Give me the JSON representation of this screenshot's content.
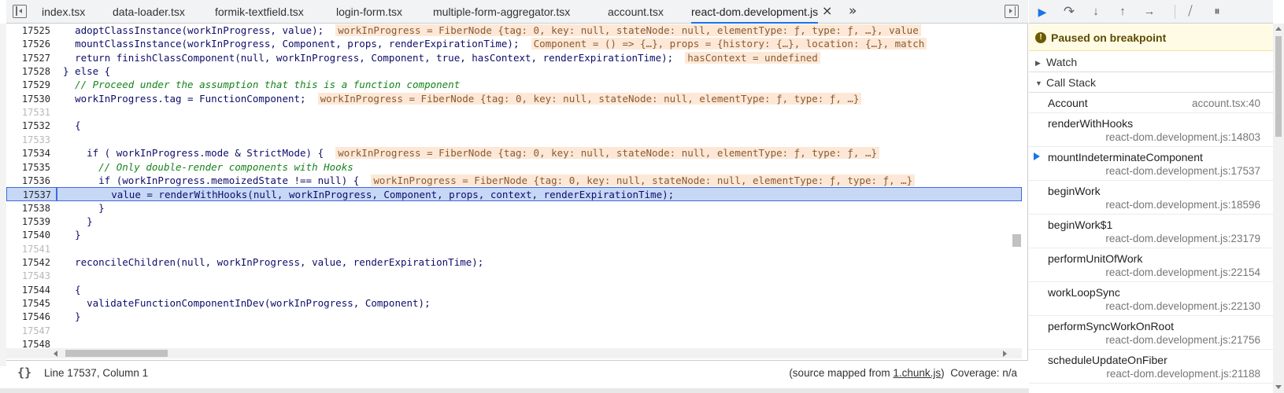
{
  "tabs": [
    {
      "label": "index.tsx",
      "active": false
    },
    {
      "label": "data-loader.tsx",
      "active": false
    },
    {
      "label": "formik-textfield.tsx",
      "active": false
    },
    {
      "label": "login-form.tsx",
      "active": false
    },
    {
      "label": "multiple-form-aggregator.tsx",
      "active": false
    },
    {
      "label": "account.tsx",
      "active": false
    },
    {
      "label": "react-dom.development.js",
      "active": true
    }
  ],
  "tab_close_glyph": "×",
  "tab_more_glyph": "»",
  "code_lines": [
    {
      "num": "17525",
      "dim": false,
      "indent": "  ",
      "code": "adoptClassInstance(workInProgress, value);",
      "inline": "workInProgress = FiberNode {tag: 0, key: null, stateNode: null, elementType: ƒ, type: ƒ, …}, value"
    },
    {
      "num": "17526",
      "dim": false,
      "indent": "  ",
      "code": "mountClassInstance(workInProgress, Component, props, renderExpirationTime);",
      "inline": "Component = () => {…}, props = {history: {…}, location: {…}, match"
    },
    {
      "num": "17527",
      "dim": false,
      "indent": "  ",
      "code": "return finishClassComponent(null, workInProgress, Component, true, hasContext, renderExpirationTime);",
      "inline": "hasContext = undefined"
    },
    {
      "num": "17528",
      "dim": false,
      "indent": "",
      "code": "} else {",
      "inline": ""
    },
    {
      "num": "17529",
      "dim": false,
      "indent": "  ",
      "code": "// Proceed under the assumption that this is a function component",
      "inline": "",
      "comment": true
    },
    {
      "num": "17530",
      "dim": false,
      "indent": "  ",
      "code": "workInProgress.tag = FunctionComponent;",
      "inline": "workInProgress = FiberNode {tag: 0, key: null, stateNode: null, elementType: ƒ, type: ƒ, …}"
    },
    {
      "num": "17531",
      "dim": true,
      "indent": "",
      "code": "",
      "inline": ""
    },
    {
      "num": "17532",
      "dim": false,
      "indent": "  ",
      "code": "{",
      "inline": ""
    },
    {
      "num": "17533",
      "dim": true,
      "indent": "",
      "code": "",
      "inline": ""
    },
    {
      "num": "17534",
      "dim": false,
      "indent": "    ",
      "code": "if ( workInProgress.mode & StrictMode) {",
      "inline": "workInProgress = FiberNode {tag: 0, key: null, stateNode: null, elementType: ƒ, type: ƒ, …}"
    },
    {
      "num": "17535",
      "dim": false,
      "indent": "      ",
      "code": "// Only double-render components with Hooks",
      "inline": "",
      "comment": true
    },
    {
      "num": "17536",
      "dim": false,
      "indent": "      ",
      "code": "if (workInProgress.memoizedState !== null) {",
      "inline": "workInProgress = FiberNode {tag: 0, key: null, stateNode: null, elementType: ƒ, type: ƒ, …}"
    },
    {
      "num": "17537",
      "dim": false,
      "indent": "        ",
      "code": "value = renderWithHooks(null, workInProgress, Component, props, context, renderExpirationTime);",
      "inline": "",
      "current": true
    },
    {
      "num": "17538",
      "dim": false,
      "indent": "      ",
      "code": "}",
      "inline": ""
    },
    {
      "num": "17539",
      "dim": false,
      "indent": "    ",
      "code": "}",
      "inline": ""
    },
    {
      "num": "17540",
      "dim": false,
      "indent": "  ",
      "code": "}",
      "inline": ""
    },
    {
      "num": "17541",
      "dim": true,
      "indent": "",
      "code": "",
      "inline": ""
    },
    {
      "num": "17542",
      "dim": false,
      "indent": "  ",
      "code": "reconcileChildren(null, workInProgress, value, renderExpirationTime);",
      "inline": ""
    },
    {
      "num": "17543",
      "dim": true,
      "indent": "",
      "code": "",
      "inline": ""
    },
    {
      "num": "17544",
      "dim": false,
      "indent": "  ",
      "code": "{",
      "inline": ""
    },
    {
      "num": "17545",
      "dim": false,
      "indent": "    ",
      "code": "validateFunctionComponentInDev(workInProgress, Component);",
      "inline": ""
    },
    {
      "num": "17546",
      "dim": false,
      "indent": "  ",
      "code": "}",
      "inline": ""
    },
    {
      "num": "17547",
      "dim": true,
      "indent": "",
      "code": "",
      "inline": ""
    },
    {
      "num": "17548",
      "dim": false,
      "indent": "",
      "code": "",
      "inline": ""
    }
  ],
  "status": {
    "pretty_print_glyph": "{}",
    "position": "Line 17537, Column 1",
    "source_mapped_prefix": "(source mapped from ",
    "source_mapped_link": "1.chunk.js",
    "source_mapped_suffix": ")",
    "coverage": "Coverage: n/a"
  },
  "debugger": {
    "paused_text": "Paused on breakpoint",
    "paused_glyph": "!",
    "watch_label": "Watch",
    "callstack_label": "Call Stack",
    "frames": [
      {
        "fn": "Account",
        "loc": "account.tsx:40",
        "inline": true,
        "current": false
      },
      {
        "fn": "renderWithHooks",
        "loc": "react-dom.development.js:14803",
        "inline": false,
        "current": false
      },
      {
        "fn": "mountIndeterminateComponent",
        "loc": "react-dom.development.js:17537",
        "inline": false,
        "current": true
      },
      {
        "fn": "beginWork",
        "loc": "react-dom.development.js:18596",
        "inline": false,
        "current": false
      },
      {
        "fn": "beginWork$1",
        "loc": "react-dom.development.js:23179",
        "inline": false,
        "current": false
      },
      {
        "fn": "performUnitOfWork",
        "loc": "react-dom.development.js:22154",
        "inline": false,
        "current": false
      },
      {
        "fn": "workLoopSync",
        "loc": "react-dom.development.js:22130",
        "inline": false,
        "current": false
      },
      {
        "fn": "performSyncWorkOnRoot",
        "loc": "react-dom.development.js:21756",
        "inline": false,
        "current": false
      },
      {
        "fn": "scheduleUpdateOnFiber",
        "loc": "react-dom.development.js:21188",
        "inline": false,
        "current": false
      }
    ],
    "toolbar_glyphs": {
      "resume": "▶",
      "step_over": "↷",
      "step_into": "↓",
      "step_out": "↑",
      "step": "→",
      "deactivate": "⧸",
      "pause_exceptions": "⏸"
    }
  },
  "colors": {
    "accent": "#1a73e8",
    "current_line_bg": "#c7d7f6",
    "inline_value_bg": "#fde8d7",
    "paused_bg": "#fffbe5"
  }
}
